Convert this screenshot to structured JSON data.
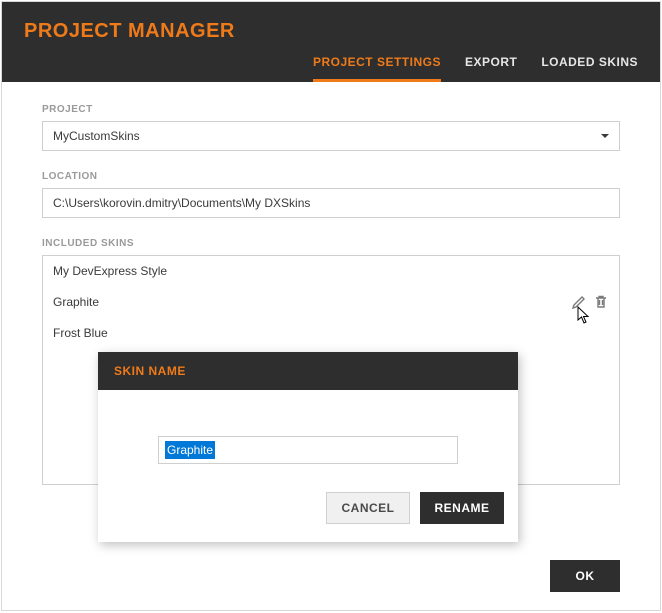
{
  "header": {
    "title": "PROJECT MANAGER"
  },
  "tabs": [
    {
      "label": "PROJECT SETTINGS",
      "active": true
    },
    {
      "label": "EXPORT",
      "active": false
    },
    {
      "label": "LOADED SKINS",
      "active": false
    }
  ],
  "project": {
    "label": "PROJECT",
    "value": "MyCustomSkins"
  },
  "location": {
    "label": "LOCATION",
    "value": "C:\\Users\\korovin.dmitry\\Documents\\My DXSkins"
  },
  "included_skins": {
    "label": "INCLUDED SKINS",
    "items": [
      {
        "name": "My DevExpress Style"
      },
      {
        "name": "Graphite"
      },
      {
        "name": "Frost Blue"
      }
    ]
  },
  "modal": {
    "title": "SKIN NAME",
    "input_value": "Graphite",
    "cancel_label": "CANCEL",
    "rename_label": "RENAME"
  },
  "footer": {
    "ok_label": "OK"
  }
}
